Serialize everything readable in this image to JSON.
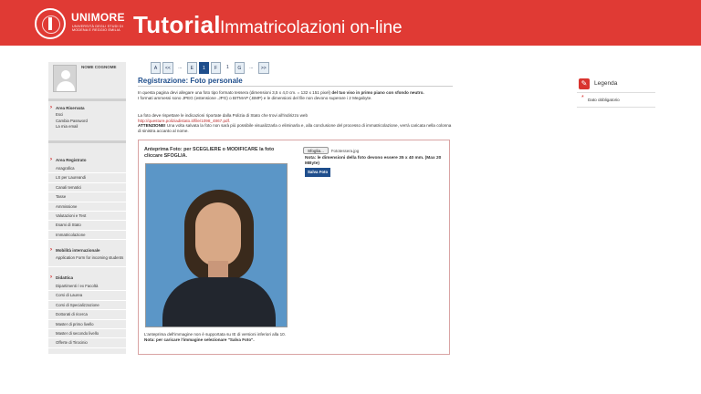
{
  "header": {
    "brand": "UNIMORE",
    "brand_sub": "UNIVERSITÀ DEGLI STUDI DI MODENA E REGGIO EMILIA",
    "title": "Tutorial",
    "subtitle": "Immatricolazioni on-line"
  },
  "sidebar": {
    "user_name": "NOME COGNOME",
    "reserved_area": {
      "heading": "Area Riservata",
      "items": [
        "Esci",
        "Cambia Password",
        "La mia email"
      ]
    },
    "registry_area": {
      "heading": "Area Registrato",
      "items": [
        "Anagrafica",
        "LS per Laureandi",
        "Canali tematici",
        "Tasse",
        "Ammissione",
        "Valutazioni e Test",
        "Esami di Stato",
        "Immatricolazione"
      ]
    },
    "mobility": {
      "heading": "Mobilità internazionale",
      "items": [
        "Application Form for incoming students"
      ]
    },
    "teaching": {
      "heading": "Didattica",
      "items": [
        "Dipartimenti / ex Facoltà",
        "Corsi di Laurea",
        "Corsi di Specializzazione",
        "Dottorati di ricerca",
        "Master di primo livello",
        "Master di secondo livello",
        "Offerte di Tirocinio"
      ]
    }
  },
  "pager": [
    "A",
    "<<",
    "...",
    "E",
    "1",
    "F",
    "1",
    "G",
    "...",
    ">>"
  ],
  "main": {
    "page_title": "Registrazione: Foto personale",
    "intro_1a": "In questa pagina devi allegare una foto tipo formato tessera (dimensioni 3,5 x 4,0 cm. = 132 x 151 pixel)",
    "intro_1b": "del tuo viso in primo piano con sfondo neutro.",
    "intro_1c": "I formati ammessi sono JPEG (estensione .JPG) o BITMAP (.BMP) e le dimensioni del file non devono superare i 2 Megabyte.",
    "intro_2a": "La foto deve rispettare le indicazioni riportate dalla Polizia di Stato che trovi all'indirizzo web",
    "intro_2_link": "http://questure.poliziadistato.it/file/1098_4867.pdf.",
    "intro_2_attn": "ATTENZIONE!",
    "intro_2b": "Una volta salvata la foto non sarà più possibile visualizzarla o eliminarla e, alla conclusione del processo di immatricolazione, verrà caricata nella colonna di sinistra accanto al nome.",
    "preview_title": "Anteprima Foto: per SCEGLIERE o MODIFICARE la foto cliccare SFOGLIA.",
    "browse_label": "Sfoglia...",
    "file_name": "Fototessera.jpg",
    "size_note": "Nota: le dimensioni della foto devono essere 35 x 40 mm. (Max 20 MByte)",
    "save_label": "Salva Foto",
    "preview_note": "L'anteprima dell'immagine non è supportata su IE di versioni inferiori alla 10.",
    "preview_note_bold": "Nota: per caricare l'immagine selezionare \"Salva Foto\"."
  },
  "legend": {
    "title": "Legenda",
    "item": "Dato obbligatorio"
  },
  "colors": {
    "header_red": "#e03a34",
    "link_blue": "#1f4e8c"
  }
}
